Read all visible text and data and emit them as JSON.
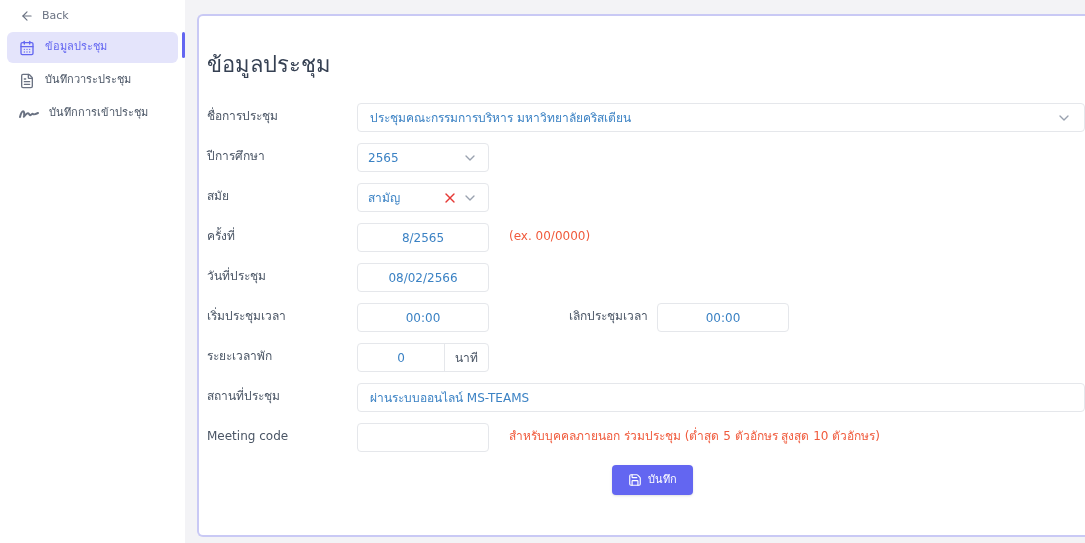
{
  "sidebar": {
    "back": {
      "label": "Back"
    },
    "items": [
      {
        "label": "ข้อมูลประชุม",
        "selected": true,
        "kind": "calendar"
      },
      {
        "label": "บันทึกวาระประชุม",
        "selected": false,
        "kind": "document"
      },
      {
        "label": "บันทึกการเข้าประชุม",
        "selected": false,
        "kind": "signature"
      }
    ]
  },
  "form": {
    "title": "ข้อมูลประชุม",
    "fields": [
      {
        "kind": "select-wide",
        "label": "ชื่อการประชุม",
        "value": "ประชุมคณะกรรมการบริหาร มหาวิทยาลัยคริสเตียน"
      },
      {
        "kind": "select",
        "label": "ปีการศึกษา",
        "value": "2565"
      },
      {
        "kind": "select-clearable",
        "label": "สมัย",
        "value": "สามัญ"
      },
      {
        "kind": "input",
        "label": "ครั้งที่",
        "value": "8/2565",
        "hint": "(ex. 00/0000)"
      },
      {
        "kind": "input",
        "label": "วันที่ประชุม",
        "value": "08/02/2566"
      },
      {
        "kind": "time-pair",
        "label": "เริ่มประชุมเวลา",
        "value": "00:00",
        "label2": "เลิกประชุมเวลา",
        "value2": "00:00"
      },
      {
        "kind": "input-unit",
        "label": "ระยะเวลาพัก",
        "value": "0",
        "unit": "นาที"
      },
      {
        "kind": "input-wide",
        "label": "สถานที่ประชุม",
        "value": "ผ่านระบบออนไลน์ MS-TEAMS"
      },
      {
        "kind": "input",
        "label": "Meeting code",
        "hint": "สำหรับบุคคลภายนอก ร่วมประชุม (ต่ำสุด 5 ตัวอักษร สูงสุด 10 ตัวอักษร)"
      }
    ],
    "save_button": {
      "label": "บันทึก"
    }
  }
}
